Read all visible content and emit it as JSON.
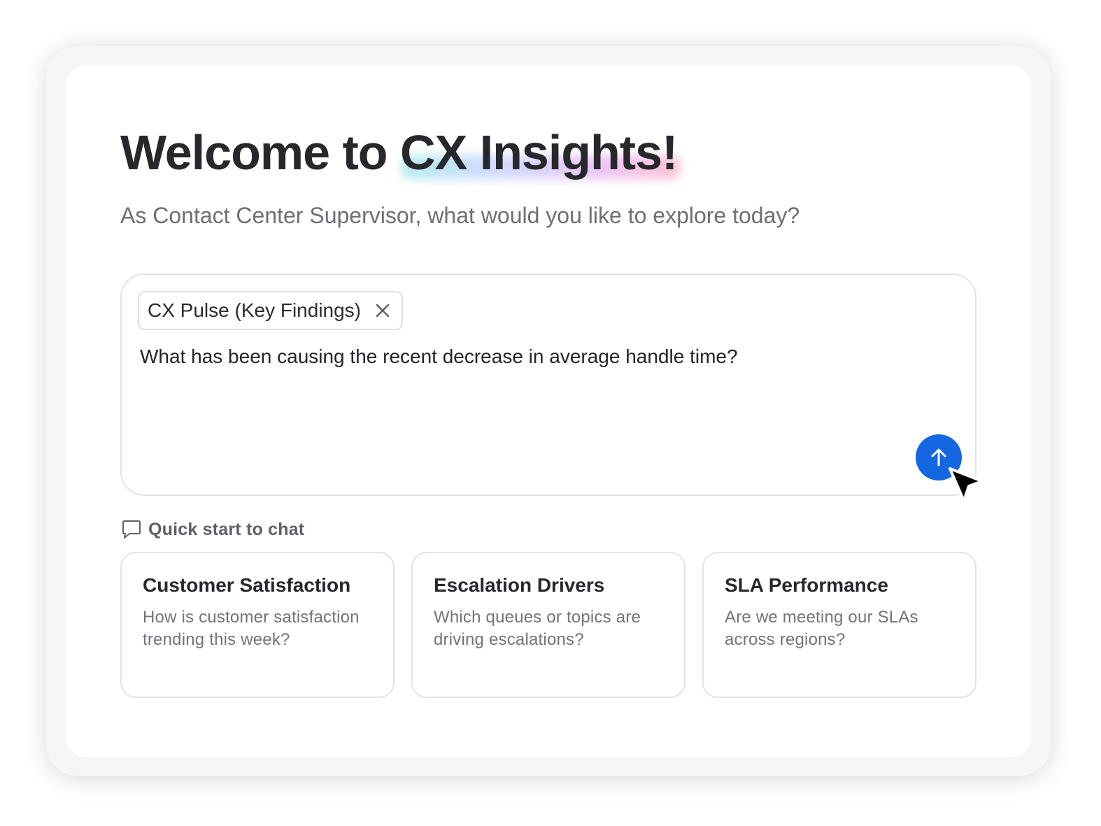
{
  "header": {
    "title_prefix": "Welcome to",
    "title_brand": "CX Insights!",
    "subtitle": "As Contact Center Supervisor, what would you like to explore today?"
  },
  "composer": {
    "context_chip": {
      "label": "CX Pulse (Key Findings)",
      "close_icon": "close-icon"
    },
    "prompt_value": "What has been causing the recent decrease in average handle time?",
    "send_icon": "arrow-up-icon",
    "send_color": "#1467e1"
  },
  "quick_start": {
    "label": "Quick start to chat",
    "icon": "chat-bubble-icon",
    "cards": [
      {
        "title": "Customer Satisfaction",
        "description": "How is customer satisfaction trending this week?"
      },
      {
        "title": "Escalation Drivers",
        "description": "Which queues or topics are driving escalations?"
      },
      {
        "title": "SLA Performance",
        "description": "Are we meeting our SLAs across regions?"
      }
    ]
  },
  "colors": {
    "accent": "#1467e1",
    "title_text": "#26282b",
    "muted_text": "#6b6f76",
    "border": "#e2e3e6"
  }
}
